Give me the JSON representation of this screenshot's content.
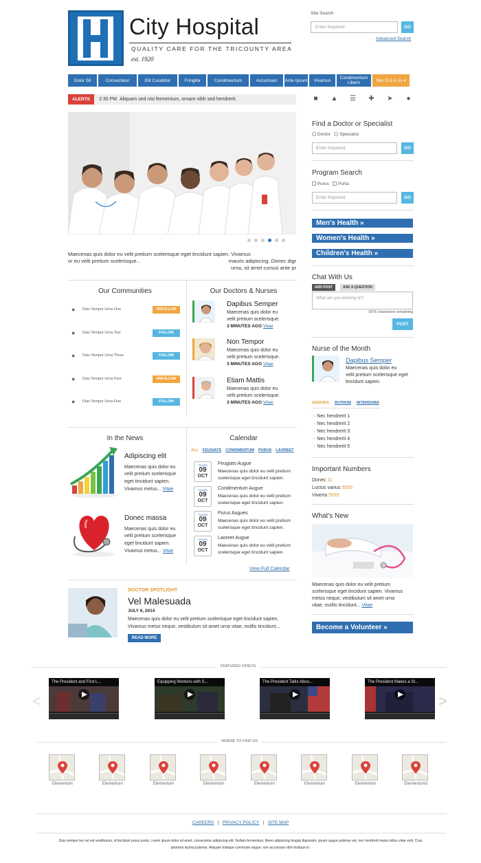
{
  "header": {
    "logo_letter": "H",
    "title": "City Hospital",
    "tagline": "QUALITY CARE FOR THE TRICOUNTY AREA",
    "established": "est. 1920",
    "search_label": "Site Search",
    "search_placeholder": "Enter Keyword",
    "go_label": "GO",
    "advanced_search": "Advanced Search"
  },
  "nav": [
    {
      "label": "Dolor Sit"
    },
    {
      "label": "Consectetur"
    },
    {
      "label": "Elit Curabitur"
    },
    {
      "label": "Fringilla"
    },
    {
      "label": "Condimentum"
    },
    {
      "label": "Accumsan"
    },
    {
      "label": "Ante Ipsum"
    },
    {
      "label": "Vivamus"
    },
    {
      "label": "Condimentum Libero"
    },
    {
      "label": "Nec Est A Us ▾"
    }
  ],
  "alerts": {
    "tag": "ALERTS",
    "time": "2:30 PM",
    "text": "Aliquam sed nisi fermentum, ornare nibh sed hendrerit."
  },
  "hero": {
    "caption_line1": "Maecenas quis dolor eu velit pretium scelerisque eget tincidunt sapien. Vivamus",
    "caption_line2": "or eu velit pretium scelerisque...",
    "caption_right1": "mauris adipiscing. Donec digr",
    "caption_right2": "urna, sit amet cursus ante pr"
  },
  "communities": {
    "title": "Our Communities",
    "items": [
      {
        "name": "Duis Tempor Urna One",
        "action": "UNFOLLOW"
      },
      {
        "name": "Duis Tempor Urna Two",
        "action": "FOLLOW"
      },
      {
        "name": "Duis Tempor Urna Three",
        "action": "FOLLOW"
      },
      {
        "name": "Duis Tempor Urna Four",
        "action": "UNFOLLOW"
      },
      {
        "name": "Duis Tempor Urna Five",
        "action": "FOLLOW"
      }
    ]
  },
  "doctors": {
    "title": "Our Doctors & Nurses",
    "items": [
      {
        "name": "Dapibus Semper",
        "desc1": "Maecenas quis dolor eu",
        "desc2": "velit pretium scelerisque.",
        "time": "3 MINUTES AGO",
        "link": "Vitae"
      },
      {
        "name": "Non Tempor",
        "desc1": "Maecenas quis dolor eu",
        "desc2": "velit pretium scelerisque.",
        "time": "3 MINUTES AGO",
        "link": "Vitae"
      },
      {
        "name": "Etiam Mattis",
        "desc1": "Maecenas quis dolor eu",
        "desc2": "velit pretium scelerisque.",
        "time": "3 MINUTES AGO",
        "link": "Vitae"
      }
    ]
  },
  "news": {
    "title": "In the News",
    "items": [
      {
        "title": "Adipiscing elit",
        "l1": "Maecenas quis dolor eu",
        "l2": "velit pretium scelerisque",
        "l3": "eget tincidunt sapien.",
        "l4": "Vivamus metus...",
        "link": "Vitae"
      },
      {
        "title": "Donec massa",
        "l1": "Maecenas quis dolor eu",
        "l2": "velit pretium scelerisque",
        "l3": "eget tincidunt sapien.",
        "l4": "Vivamus metus...",
        "link": "Vitae"
      }
    ]
  },
  "calendar": {
    "title": "Calendar",
    "filters": [
      "ALL",
      "FEUGIATS",
      "CONDIMENTUM",
      "PURUS",
      "LAOREET"
    ],
    "events": [
      {
        "day": "THURS",
        "num": "09",
        "mon": "OCT",
        "title": "Feugiats Augue",
        "d1": "Maecenas quis dolor eu velit pretium",
        "d2": "scelerisque eget tincidunt sapien."
      },
      {
        "day": "THURS",
        "num": "09",
        "mon": "OCT",
        "title": "Condimentum Augue",
        "d1": "Maecenas quis dolor eu velit pretium",
        "d2": "scelerisque eget tincidunt sapien."
      },
      {
        "day": "THURS",
        "num": "09",
        "mon": "OCT",
        "title": "Purus Augues",
        "d1": "Maecenas quis dolor eu velit pretium",
        "d2": "scelerisque eget tincidunt sapien."
      },
      {
        "day": "THURS",
        "num": "09",
        "mon": "OCT",
        "title": "Laoreet Augue",
        "d1": "Maecenas quis dolor eu velit pretium",
        "d2": "scelerisque eget tincidunt sapien."
      }
    ],
    "full_link": "View Full Calendar"
  },
  "spotlight": {
    "tag": "DOCTOR SPOTLIGHT",
    "name": "Vel Malesuada",
    "date": "JULY 6, 2014",
    "l1": "Maecenas quis dolor eu velit pretium scelerisque eget tincidunt sapien.",
    "l2": "Vivamus metus neque, vestibulum sit amet urna vitae, mollis tincidunt...",
    "button": "READ MORE"
  },
  "sidebar": {
    "find_title": "Find a Doctor or Specialist",
    "radio1": "Doctor",
    "radio2": "Specialist",
    "find_placeholder": "Enter Keyword",
    "go_label": "GO",
    "program_title": "Program Search",
    "check1": "Purus",
    "check2": "Porta",
    "program_placeholder": "Enter Keyword",
    "health_links": [
      "Men's Health »",
      "Women's Health »",
      "Children's Health »"
    ],
    "chat_title": "Chat With Us",
    "chat_tab1": "ADD POST",
    "chat_tab2": "ASK A QUESTION",
    "chat_placeholder": "What are you working on?",
    "chat_remaining": "1876 characters remaining",
    "post_label": "POST",
    "nurse_title": "Nurse of the Month",
    "nurse_name": "Dapibus Semper",
    "nurse_l1": "Maecenas quis dolor eu",
    "nurse_l2": "velit pretium scelerisque eget",
    "nurse_l3": "tincidunt sapien.",
    "categories": [
      "GRAVIDA",
      "RUTRUM",
      "INTERDUMA"
    ],
    "list": [
      "Nec hendrerit 1",
      "Nec hendrerit 2",
      "Nec hendrerit 3",
      "Nec hendrerit 4",
      "Nec hendrerit 5"
    ],
    "numbers_title": "Important Numbers",
    "numbers": [
      {
        "label": "Donec",
        "value": "11"
      },
      {
        "label": "Luctus varius",
        "value": "5550"
      },
      {
        "label": "Viverra",
        "value": "5555"
      }
    ],
    "whats_new_title": "What's New",
    "wn_l1": "Maecenas quis dolor eu velit pretium",
    "wn_l2": "scelerisque eget tincidunt sapien. Vivamus",
    "wn_l3": "metus neque, vestibulum sit amet urna",
    "wn_l4": "vitae, mollis tincidunt...",
    "wn_link": "Vitae",
    "volunteer": "Become a Volunteer »"
  },
  "videos": {
    "title": "FEATURED VIDEOS",
    "items": [
      {
        "title": "The President and First L..."
      },
      {
        "title": "Equipping Workers with S..."
      },
      {
        "title": "The President Talks Abou..."
      },
      {
        "title": "The President Makes a St..."
      }
    ]
  },
  "find_us": {
    "title": "WHERE TO FIND US",
    "items": [
      "Elementum",
      "Elementum",
      "Elementum",
      "Elementum",
      "Elementum",
      "Elementum",
      "Elementum",
      "Elementumd"
    ]
  },
  "footer": {
    "links": [
      "CAREERS",
      "PRIVACY POLICY",
      "SITE MAP"
    ],
    "text1": "Duis semper leo vel est vestibulum, id tincidunt purus porta. Lorem ipsum dolor sit amet, consectetur adipiscing elit. Nullam fermentum, libero adipiscing feugiat dignissim, ipsum augue pulvinar est, nec hendrerit metus tellus vitae velit. Cras",
    "text2": "pharetra lacinia pulvinar. Aliquam tristique commodo augue, non accumsan nibh tristique in."
  },
  "colors": {
    "brand_blue": "#2f6fb1",
    "accent_orange": "#f0a640",
    "alert_red": "#d9423a",
    "light_blue": "#55b7e0"
  }
}
